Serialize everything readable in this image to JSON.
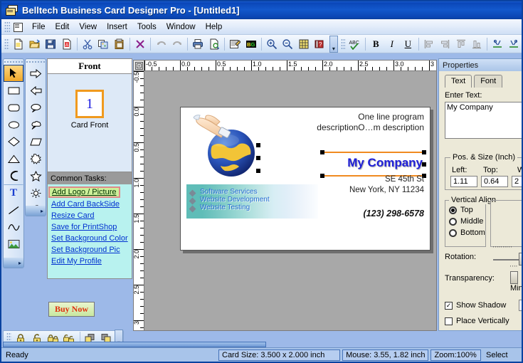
{
  "window": {
    "title": "Belltech Business Card Designer Pro  - [Untitled1]",
    "icon": "card-stack-icon"
  },
  "menu": {
    "items": [
      "File",
      "Edit",
      "View",
      "Insert",
      "Tools",
      "Window",
      "Help"
    ]
  },
  "toolbar": {
    "buttons": [
      {
        "name": "new-icon",
        "glyph": "new"
      },
      {
        "name": "open-icon",
        "glyph": "open"
      },
      {
        "name": "save-icon",
        "glyph": "save"
      },
      {
        "name": "export-pdf-icon",
        "glyph": "pdf"
      },
      {
        "name": "cut-icon",
        "glyph": "cut"
      },
      {
        "name": "copy-icon",
        "glyph": "copy"
      },
      {
        "name": "paste-icon",
        "glyph": "paste"
      },
      {
        "name": "delete-icon",
        "glyph": "delete"
      },
      {
        "name": "undo-icon",
        "glyph": "undo"
      },
      {
        "name": "redo-icon",
        "glyph": "redo"
      },
      {
        "name": "print-icon",
        "glyph": "print"
      },
      {
        "name": "print-preview-icon",
        "glyph": "preview"
      },
      {
        "name": "properties-icon",
        "glyph": "props"
      },
      {
        "name": "background-icon",
        "glyph": "bg"
      },
      {
        "name": "zoom-in-icon",
        "glyph": "zoomin"
      },
      {
        "name": "zoom-out-icon",
        "glyph": "zoomout"
      },
      {
        "name": "grid-icon",
        "glyph": "grid"
      },
      {
        "name": "help-icon",
        "glyph": "help"
      }
    ],
    "buttons2": [
      {
        "name": "spell-check-icon",
        "glyph": "abc"
      },
      {
        "name": "bold-icon",
        "glyph": "B"
      },
      {
        "name": "italic-icon",
        "glyph": "I"
      },
      {
        "name": "underline-icon",
        "glyph": "U"
      },
      {
        "name": "align-left-icon",
        "glyph": "al"
      },
      {
        "name": "align-right-icon",
        "glyph": "ar"
      },
      {
        "name": "align-top-icon",
        "glyph": "at"
      },
      {
        "name": "align-bottom-icon",
        "glyph": "ab"
      },
      {
        "name": "distribute-horizontal-icon",
        "glyph": "dh"
      },
      {
        "name": "distribute-vertical-icon",
        "glyph": "dv"
      }
    ],
    "overflow_label": "▾"
  },
  "toolbox": {
    "column1": [
      {
        "name": "select-tool",
        "label": "Select",
        "selected": true
      },
      {
        "name": "rectangle-tool",
        "label": "Rectangle"
      },
      {
        "name": "rounded-rectangle-tool",
        "label": "Rounded Rectangle"
      },
      {
        "name": "ellipse-tool",
        "label": "Ellipse"
      },
      {
        "name": "diamond-tool",
        "label": "Diamond"
      },
      {
        "name": "triangle-tool",
        "label": "Triangle"
      },
      {
        "name": "arc-tool",
        "label": "Arc"
      },
      {
        "name": "text-tool",
        "label": "Text"
      },
      {
        "name": "line-tool",
        "label": "Line"
      },
      {
        "name": "curve-tool",
        "label": "Curve"
      },
      {
        "name": "picture-tool",
        "label": "Picture"
      }
    ],
    "column2": [
      {
        "name": "arrow-right-tool",
        "label": "Right Arrow"
      },
      {
        "name": "arrow-left-tool",
        "label": "Left Arrow"
      },
      {
        "name": "callout-oval-tool",
        "label": "Oval Callout"
      },
      {
        "name": "callout-cloud-tool",
        "label": "Cloud Callout"
      },
      {
        "name": "parallelogram-tool",
        "label": "Parallelogram"
      },
      {
        "name": "explosion-tool",
        "label": "Explosion"
      },
      {
        "name": "star-tool",
        "label": "Star"
      },
      {
        "name": "sun-tool",
        "label": "Sun"
      },
      {
        "name": "moon-tool",
        "label": "Moon"
      }
    ]
  },
  "mini_toolbar": {
    "buttons": [
      {
        "name": "lock-icon",
        "glyph": "lock"
      },
      {
        "name": "unlock-icon",
        "glyph": "unlock"
      },
      {
        "name": "lock-all-icon",
        "glyph": "lockall"
      },
      {
        "name": "unlock-all-icon",
        "glyph": "unlockall"
      },
      {
        "name": "bring-to-front-icon",
        "glyph": "front"
      },
      {
        "name": "send-to-back-icon",
        "glyph": "back"
      }
    ],
    "overflow_label": "▾"
  },
  "front_panel": {
    "header": "Front",
    "thumb_number": "1",
    "thumb_label": "Card Front"
  },
  "common_tasks": {
    "header": "Common Tasks:",
    "items": [
      {
        "label": "Add Logo / Picture",
        "active": true
      },
      {
        "label": "Add Card BackSide",
        "active": false
      },
      {
        "label": "Resize Card",
        "active": false
      },
      {
        "label": "Save for PrintShop",
        "active": false
      },
      {
        "label": "Set Background Color",
        "active": false
      },
      {
        "label": "Set Background Pic",
        "active": false
      },
      {
        "label": "Edit My Profile",
        "active": false
      }
    ],
    "buy_now": "Buy Now"
  },
  "rulers": {
    "horizontal_labels": [
      "-0.5",
      "0.0",
      "0.5",
      "1.0",
      "1.5",
      "2.0",
      "2.5",
      "3.0",
      "3"
    ],
    "vertical_labels": [
      "-0.5",
      "0.0",
      "0.5",
      "1.0",
      "1.5",
      "2.0",
      "2.5",
      "3"
    ],
    "unit": "inch"
  },
  "card": {
    "tagline_line1": "One line program",
    "tagline_line2": "descriptionO…m description",
    "company": "My Company",
    "address_line1": "SE 45th St",
    "address_line2": "New York, NY 11234",
    "phone": "(123) 298-6578",
    "services": [
      "Software Services",
      "Website Development",
      "Website Testing"
    ],
    "accent_color": "#f08a20",
    "company_color": "#2020d8",
    "service_color": "#2b6fd4"
  },
  "properties": {
    "title": "Properties",
    "tabs": [
      {
        "label": "Text",
        "selected": true
      },
      {
        "label": "Font",
        "selected": false
      }
    ],
    "enter_text_label": "Enter Text:",
    "text_value": "My Company",
    "pos_size_legend": "Pos. & Size (Inch)",
    "left_label": "Left:",
    "left_value": "1.11",
    "top_label": "Top:",
    "top_value": "0.64",
    "width_label": "W",
    "width_value": "2",
    "vertical_align_legend": "Vertical Align",
    "vertical_align_options": [
      {
        "label": "Top",
        "selected": true
      },
      {
        "label": "Middle",
        "selected": false
      },
      {
        "label": "Bottom",
        "selected": false
      }
    ],
    "rotation_label": "Rotation:",
    "transparency_label": "Transparency:",
    "transparency_min_label": "Min",
    "show_shadow_label": "Show Shadow",
    "show_shadow_checked": true,
    "place_vertically_label": "Place Vertically",
    "place_vertically_checked": false
  },
  "statusbar": {
    "ready": "Ready",
    "card_size": "Card Size: 3.500 x 2.000 inch",
    "mouse": "Mouse: 3.55, 1.82 inch",
    "zoom": "Zoom:100%",
    "mode": "Select"
  }
}
